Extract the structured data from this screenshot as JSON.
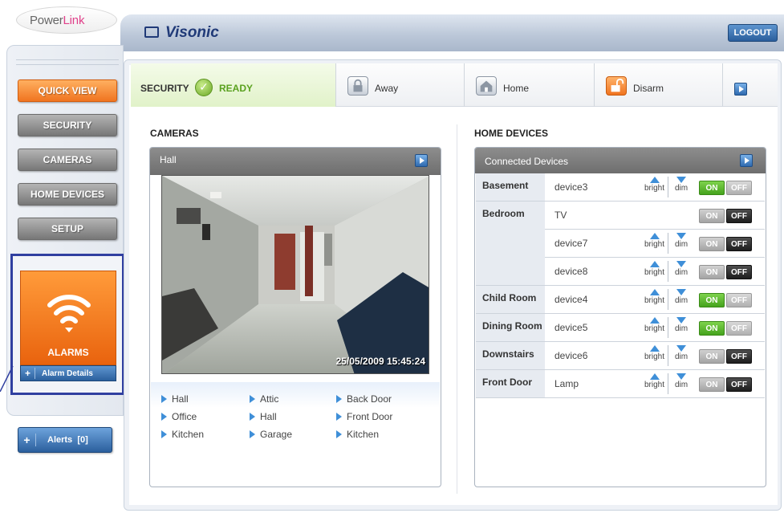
{
  "logo": {
    "text_a": "Power",
    "text_b": "Link"
  },
  "header": {
    "brand": "Visonic",
    "logout_label": "LOGOUT"
  },
  "nav": {
    "quick_view": "QUICK VIEW",
    "security": "SECURITY",
    "cameras": "CAMERAS",
    "home_devices": "HOME DEVICES",
    "setup": "SETUP"
  },
  "alarms": {
    "label": "ALARMS",
    "details_plus": "+",
    "details_label": "Alarm Details"
  },
  "alerts": {
    "plus": "+",
    "label": "Alerts",
    "count": "[0]"
  },
  "status": {
    "security_label": "SECURITY",
    "ready_label": "READY",
    "away_label": "Away",
    "home_label": "Home",
    "disarm_label": "Disarm"
  },
  "cameras": {
    "section_title": "CAMERAS",
    "current": "Hall",
    "timestamp": "25/05/2009 15:45:24",
    "list": [
      [
        "Hall",
        "Attic",
        "Back Door"
      ],
      [
        "Office",
        "Hall",
        "Front Door"
      ],
      [
        "Kitchen",
        "Garage",
        "Kitchen"
      ]
    ]
  },
  "devices": {
    "section_title": "HOME DEVICES",
    "panel_title": "Connected Devices",
    "bright_label": "bright",
    "dim_label": "dim",
    "on_label": "ON",
    "off_label": "OFF",
    "rooms": [
      {
        "name": "Basement",
        "devices": [
          {
            "name": "device3",
            "dimmable": true,
            "state": "on"
          }
        ]
      },
      {
        "name": "Bedroom",
        "devices": [
          {
            "name": "TV",
            "dimmable": false,
            "state": "off"
          },
          {
            "name": "device7",
            "dimmable": true,
            "state": "off"
          },
          {
            "name": "device8",
            "dimmable": true,
            "state": "off"
          }
        ]
      },
      {
        "name": "Child Room",
        "devices": [
          {
            "name": "device4",
            "dimmable": true,
            "state": "on"
          }
        ]
      },
      {
        "name": "Dining Room",
        "devices": [
          {
            "name": "device5",
            "dimmable": true,
            "state": "on"
          }
        ]
      },
      {
        "name": "Downstairs",
        "devices": [
          {
            "name": "device6",
            "dimmable": true,
            "state": "off"
          }
        ]
      },
      {
        "name": "Front Door",
        "devices": [
          {
            "name": "Lamp",
            "dimmable": true,
            "state": "off"
          }
        ]
      }
    ]
  },
  "colors": {
    "accent_orange": "#f07420",
    "accent_blue": "#2b5f9d",
    "ready_green": "#5aa11f"
  }
}
